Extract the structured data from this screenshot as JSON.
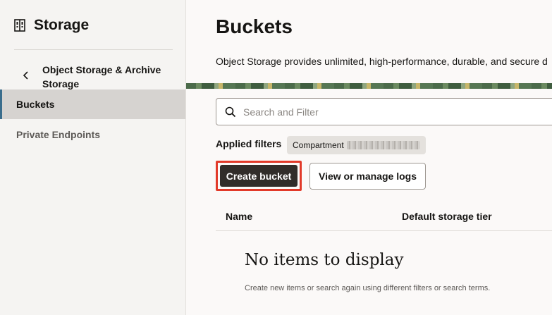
{
  "sidebar": {
    "title": "Storage",
    "icon": "storage-icon",
    "back_icon": "chevron-left-icon",
    "parent_label": "Object Storage & Archive Storage",
    "items": [
      {
        "label": "Buckets",
        "active": true
      },
      {
        "label": "Private Endpoints",
        "active": false
      }
    ]
  },
  "main": {
    "title": "Buckets",
    "description": "Object Storage provides unlimited, high-performance, durable, and secure d",
    "search": {
      "placeholder": "Search and Filter",
      "value": "",
      "icon": "search-icon"
    },
    "filters": {
      "label": "Applied filters",
      "chip_label": "Compartment"
    },
    "buttons": {
      "create": "Create bucket",
      "logs": "View or manage logs"
    },
    "table": {
      "columns": [
        "Name",
        "Default storage tier"
      ]
    },
    "empty": {
      "title": "No items to display",
      "description": "Create new items or search again using different filters or search terms."
    }
  },
  "colors": {
    "primary_button": "#312d2a",
    "highlight_border": "#e23a2a",
    "active_item": "#d6d3d0",
    "active_marker": "#3a6d8c"
  }
}
